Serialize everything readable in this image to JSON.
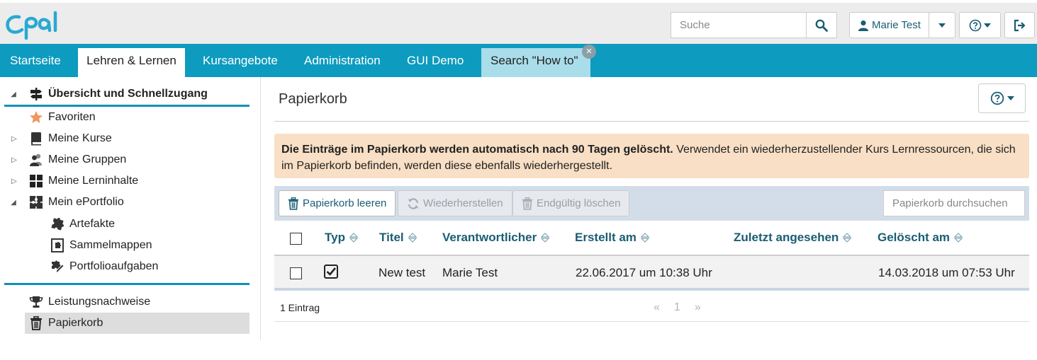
{
  "header": {
    "logo_text": "Opal",
    "search_placeholder": "Suche",
    "user_name": "Marie Test"
  },
  "nav": {
    "tabs": [
      "Startseite",
      "Lehren & Lernen",
      "Kursangebote",
      "Administration",
      "GUI Demo",
      "Search \"How to\""
    ],
    "active_tab": "Lehren & Lernen",
    "close_symbol": "×"
  },
  "sidebar": {
    "section_title": "Übersicht und Schnellzugang",
    "items": [
      {
        "label": "Favoriten",
        "icon": "star-icon"
      },
      {
        "label": "Meine Kurse",
        "icon": "book-icon"
      },
      {
        "label": "Meine Gruppen",
        "icon": "group-icon"
      },
      {
        "label": "Meine Lerninhalte",
        "icon": "grid-icon"
      },
      {
        "label": "Mein ePortfolio",
        "icon": "puzzle-grid-icon"
      },
      {
        "label": "Artefakte",
        "icon": "puzzle-icon"
      },
      {
        "label": "Sammelmappen",
        "icon": "binder-icon"
      },
      {
        "label": "Portfolioaufgaben",
        "icon": "puzzle-pen-icon"
      },
      {
        "label": "Leistungsnachweise",
        "icon": "trophy-icon"
      },
      {
        "label": "Papierkorb",
        "icon": "trash-icon"
      }
    ],
    "selected": "Papierkorb"
  },
  "main": {
    "title": "Papierkorb",
    "alert_bold": "Die Einträge im Papierkorb werden automatisch nach 90 Tagen gelöscht.",
    "alert_text": " Verwendet ein wiederherzustellender Kurs Lernressourcen, die sich im Papierkorb befinden, werden diese ebenfalls wiederhergestellt.",
    "toolbar": {
      "empty_label": "Papierkorb leeren",
      "restore_label": "Wiederherstellen",
      "delete_label": "Endgültig löschen",
      "search_placeholder": "Papierkorb durchsuchen"
    },
    "table": {
      "columns": [
        "Typ",
        "Titel",
        "Verantwortlicher",
        "Erstellt am",
        "Zuletzt angesehen",
        "Gelöscht am"
      ],
      "rows": [
        {
          "type_icon": "checkbox-course-icon",
          "title": "New test",
          "owner": "Marie Test",
          "created": "22.06.2017 um 10:38 Uhr",
          "last_viewed": "",
          "deleted": "14.03.2018 um 07:53 Uhr"
        }
      ]
    },
    "footer": {
      "count": "1 Eintrag",
      "prev": "«",
      "page": "1",
      "next": "»"
    }
  },
  "colors": {
    "primary": "#0d9bbf",
    "link_dark": "#1a5d73",
    "alert_bg": "#f8dfc5",
    "toolbar_bg": "#d3dde9"
  }
}
